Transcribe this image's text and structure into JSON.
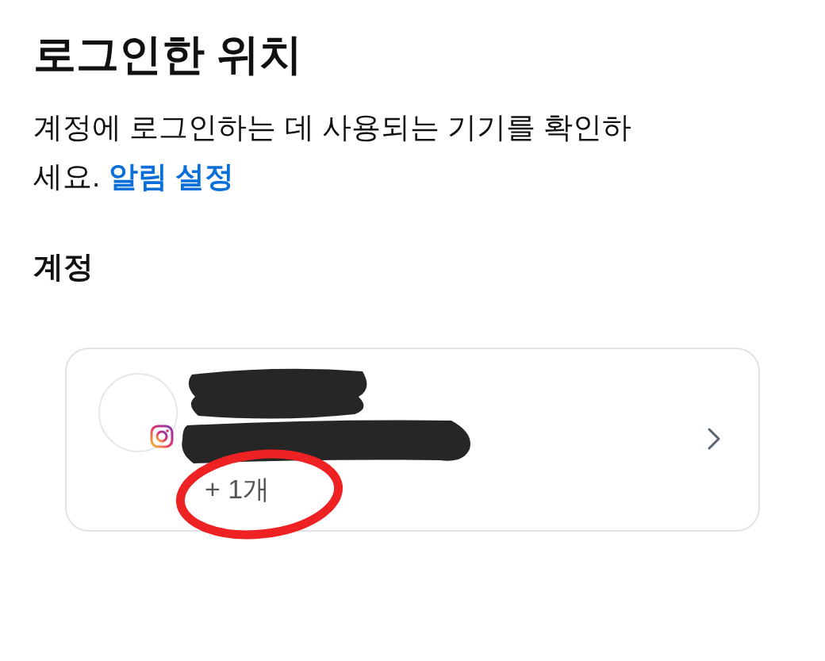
{
  "title": "로그인한 위치",
  "description": {
    "text": "계정에 로그인하는 데 사용되는 기기를 확인하세요.",
    "link": "알림 설정"
  },
  "section_heading": "계정",
  "accounts": [
    {
      "extra_count": "+ 1개"
    }
  ]
}
